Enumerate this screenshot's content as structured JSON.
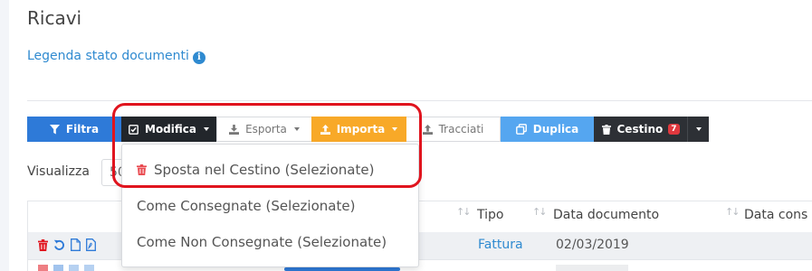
{
  "page": {
    "title": "Ricavi",
    "legend_link": "Legenda stato documenti"
  },
  "toolbar": {
    "filtra": "Filtra",
    "modifica": "Modifica",
    "esporta": "Esporta",
    "importa": "Importa",
    "tracciati": "Tracciati",
    "duplica": "Duplica",
    "cestino": "Cestino",
    "cestino_count": "7"
  },
  "dropdown": {
    "items": [
      "Sposta nel Cestino (Selezionate)",
      "Come Consegnate (Selezionate)",
      "Come Non Consegnate (Selezionate)"
    ]
  },
  "visualizza": {
    "label": "Visualizza",
    "value": "50"
  },
  "table": {
    "columns": [
      "Tipo",
      "Data documento",
      "Data cons"
    ],
    "rows": [
      {
        "tipo": "Fattura",
        "data_documento": "02/03/2019"
      }
    ]
  },
  "colors": {
    "primary": "#2e7ad8",
    "dark": "#22262b",
    "warning": "#f8a928",
    "info": "#55a6f0",
    "danger": "#e0383e",
    "link": "#2f8ad0",
    "highlight": "#e0141e"
  },
  "icons": [
    "filter-icon",
    "check-square-icon",
    "download-icon",
    "upload-icon",
    "list-icon",
    "copy-icon",
    "trash-icon",
    "info-icon",
    "refresh-icon",
    "file-icon",
    "pdf-icon",
    "caret-down-icon",
    "sort-icon"
  ]
}
